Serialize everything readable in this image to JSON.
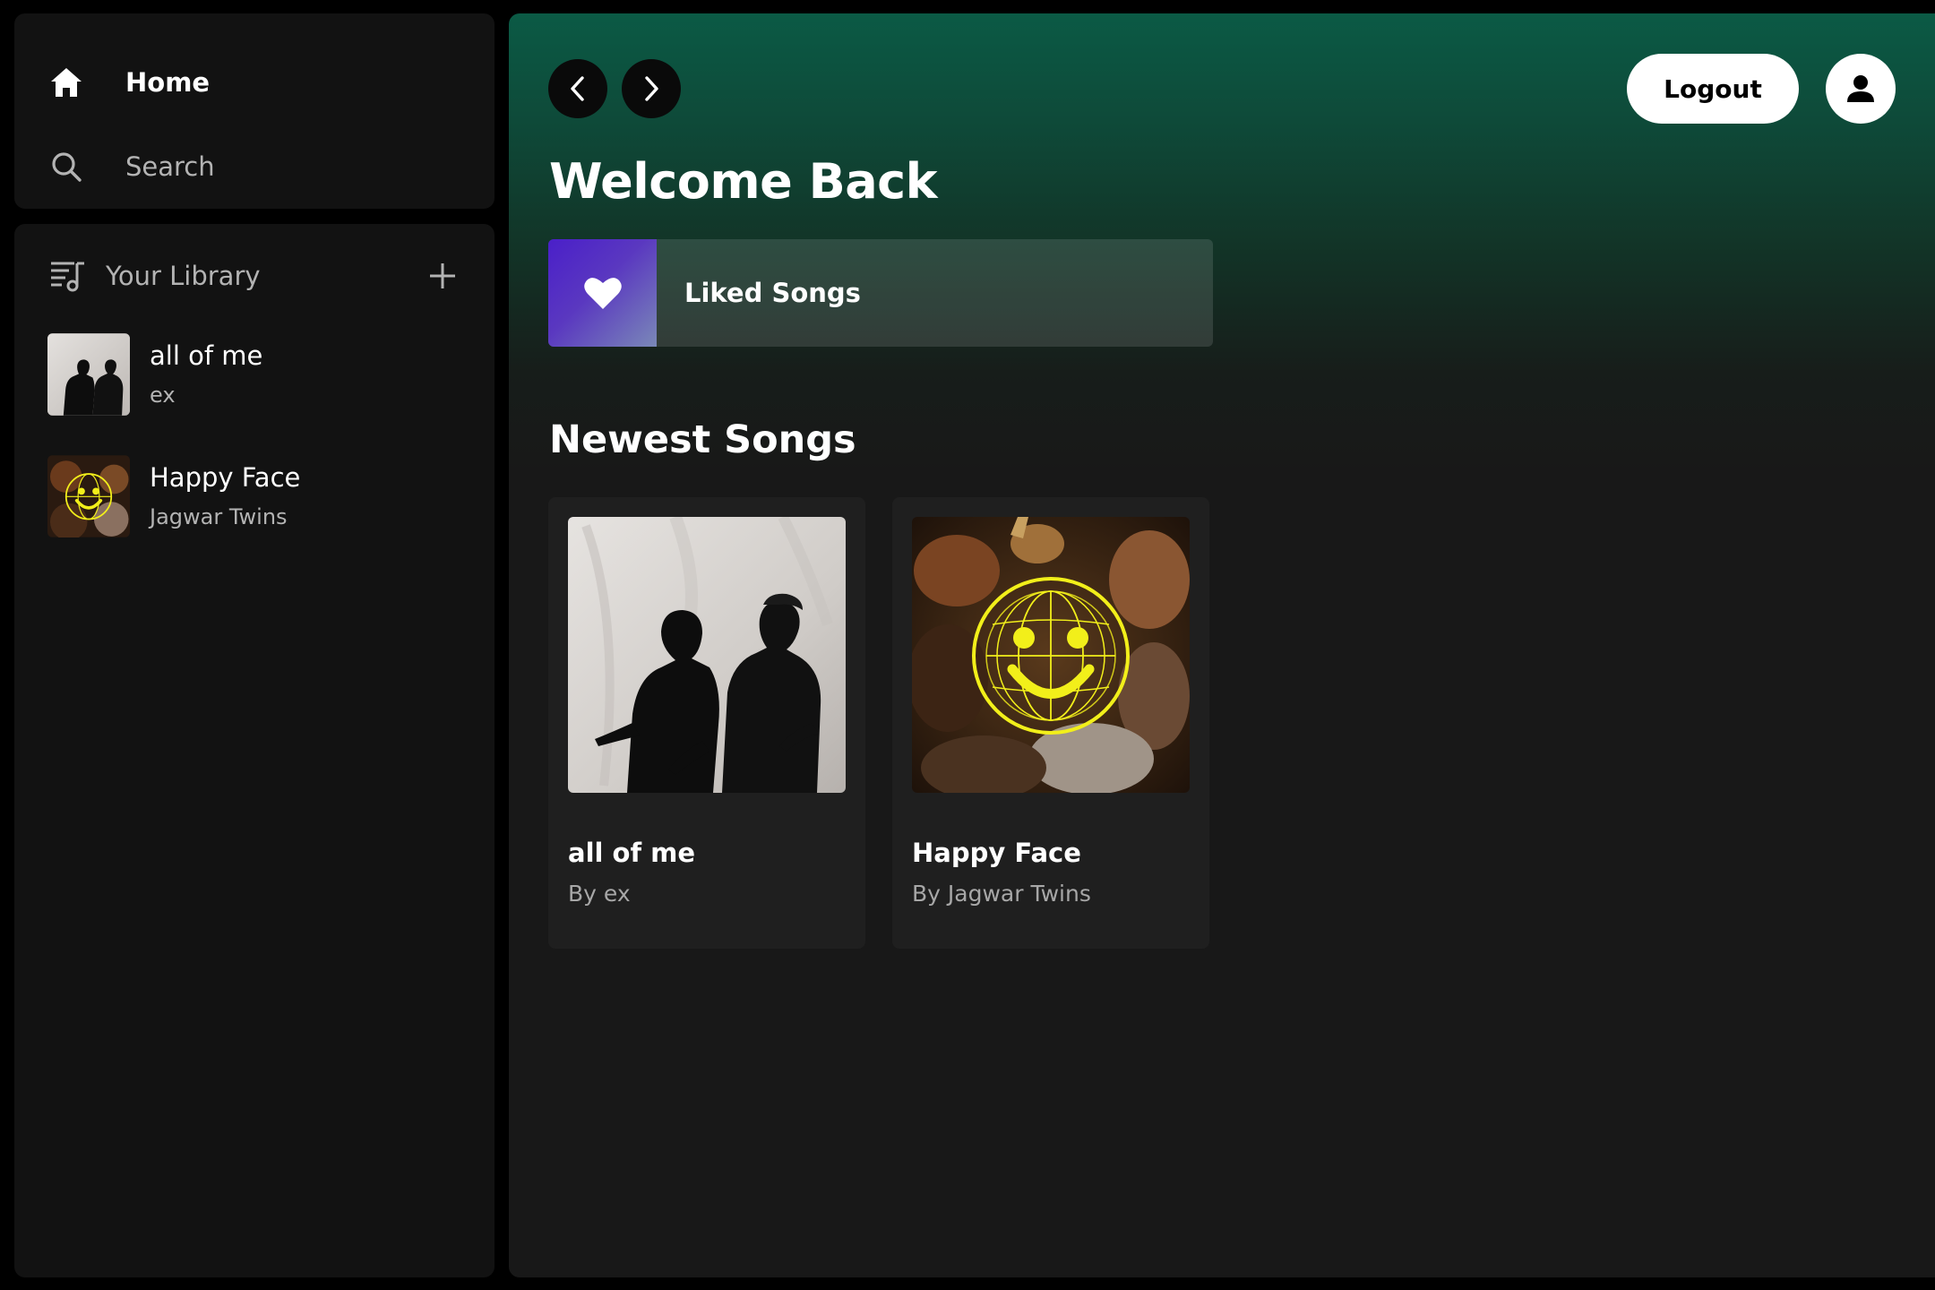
{
  "sidebar": {
    "nav": {
      "home_label": "Home",
      "search_label": "Search"
    },
    "library": {
      "title": "Your Library",
      "items": [
        {
          "name": "all of me",
          "artist": "ex",
          "cover_icon": "album-cover-all-of-me"
        },
        {
          "name": "Happy Face",
          "artist": "Jagwar Twins",
          "cover_icon": "album-cover-happy-face"
        }
      ]
    }
  },
  "header": {
    "logout_label": "Logout",
    "back_icon": "chevron-left-icon",
    "forward_icon": "chevron-right-icon",
    "profile_icon": "user-icon"
  },
  "main": {
    "welcome_title": "Welcome Back",
    "liked_songs_label": "Liked Songs",
    "newest_title": "Newest Songs",
    "newest_songs": [
      {
        "title": "all of me",
        "artist_prefix": "By",
        "artist": "ex"
      },
      {
        "title": "Happy Face",
        "artist_prefix": "By",
        "artist": "Jagwar Twins"
      }
    ]
  },
  "colors": {
    "accent_green": "#0b5a45",
    "liked_gradient_start": "#4a1fc9",
    "liked_gradient_end": "#7a88b8",
    "smiley_yellow": "#f2ef1a"
  }
}
